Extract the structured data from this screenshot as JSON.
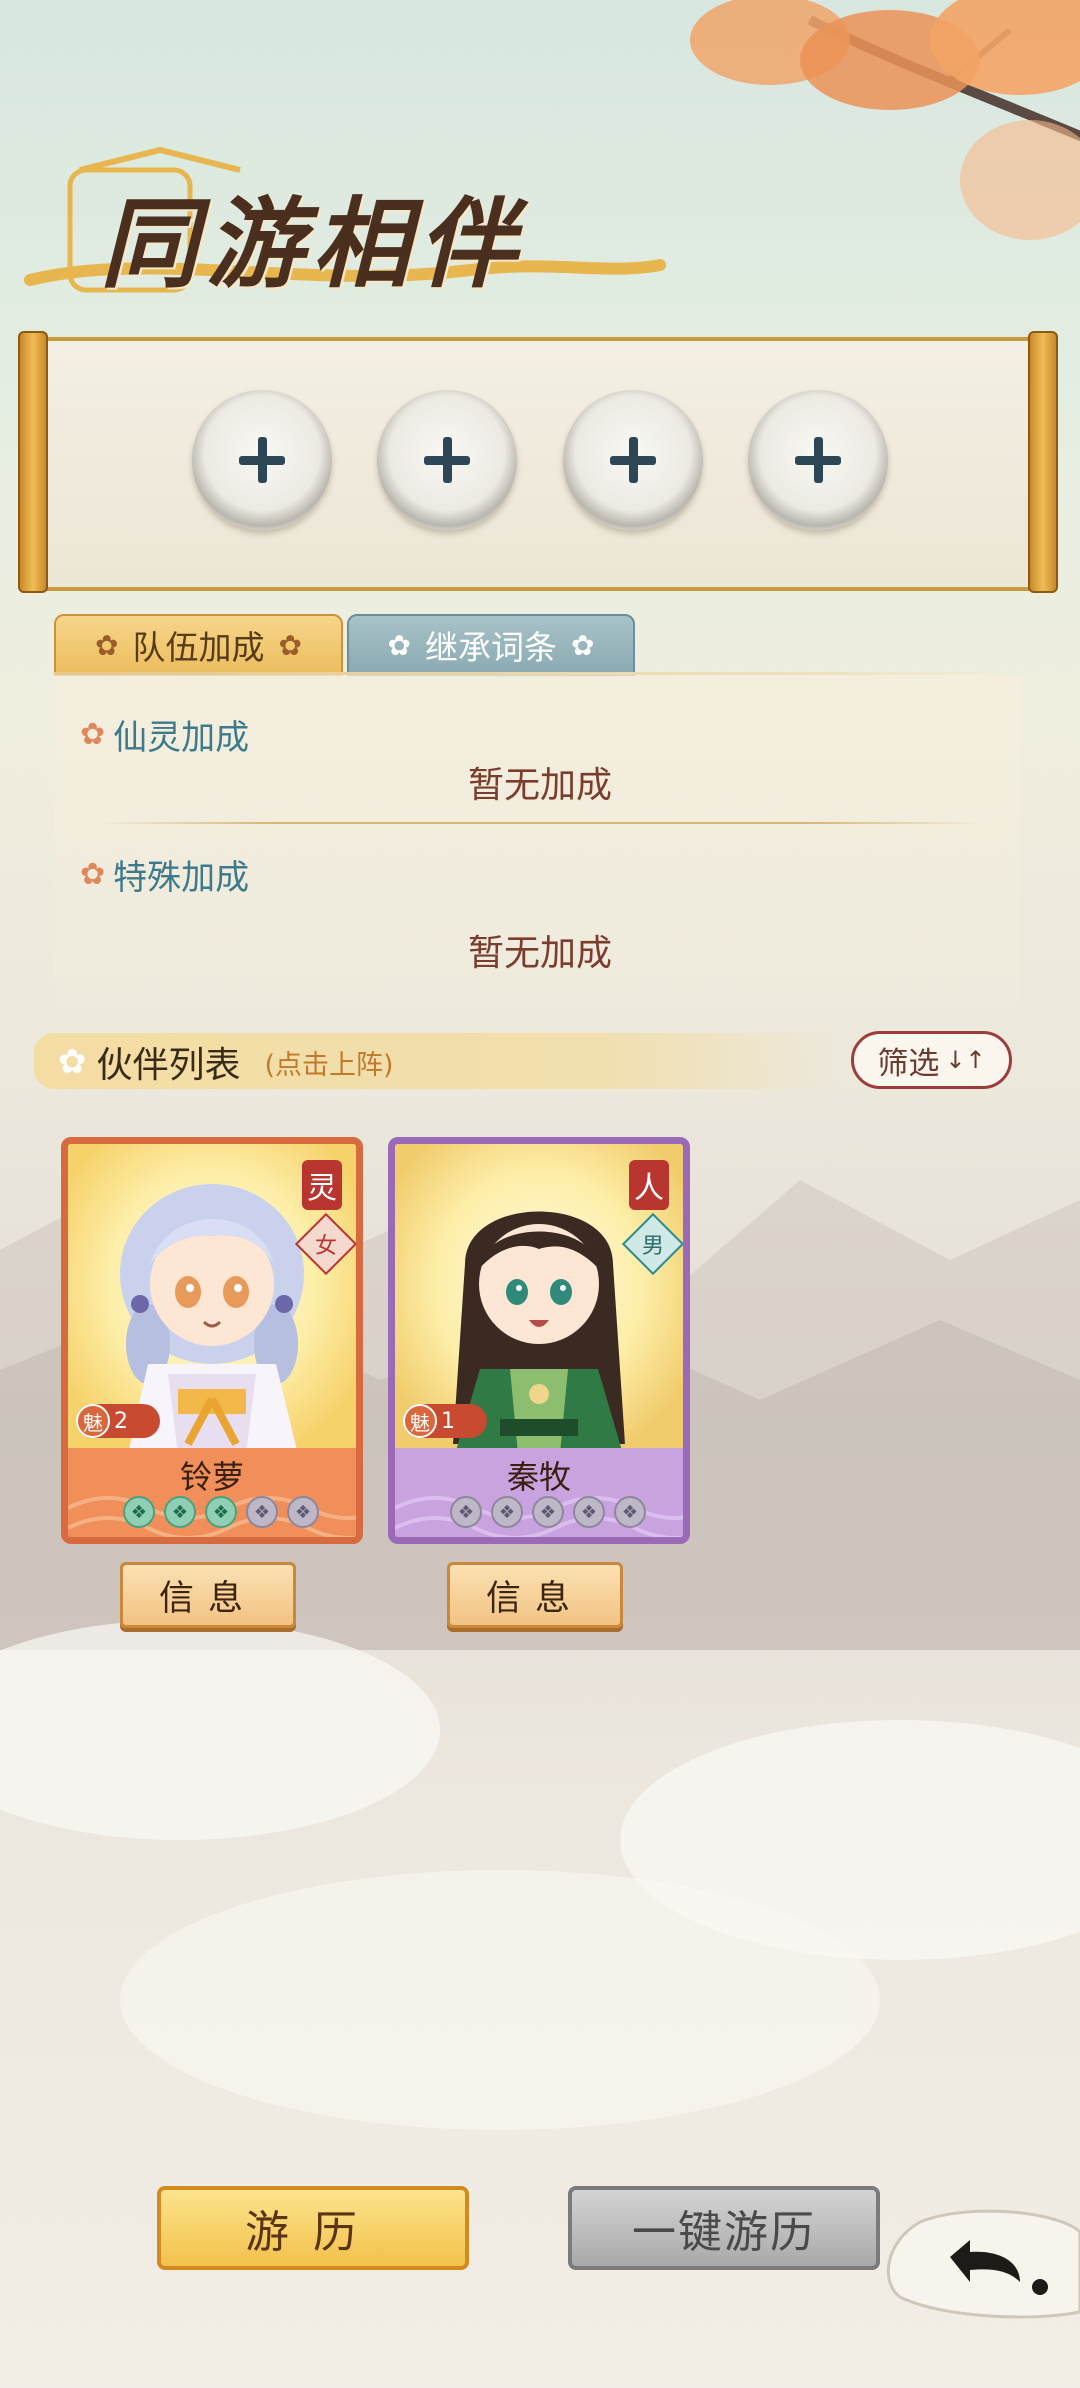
{
  "header": {
    "title": "同游相伴"
  },
  "team_slots": [
    {
      "icon": "plus-icon"
    },
    {
      "icon": "plus-icon"
    },
    {
      "icon": "plus-icon"
    },
    {
      "icon": "plus-icon"
    }
  ],
  "tabs": [
    {
      "label": "队伍加成",
      "active": true
    },
    {
      "label": "继承词条",
      "active": false
    }
  ],
  "bonuses": [
    {
      "label": "仙灵加成",
      "value": "暂无加成"
    },
    {
      "label": "特殊加成",
      "value": "暂无加成"
    }
  ],
  "companion_list": {
    "title": "伙伴列表",
    "hint": "(点击上阵)",
    "filter_label": "筛选",
    "filter_icon": "↓↑"
  },
  "companions": [
    {
      "name": "铃萝",
      "type": "灵",
      "gender": "女",
      "charm_label": "魅",
      "charm_value": "2",
      "gems_active": 3,
      "gems_total": 5,
      "info_label": "信息",
      "frame_color": "#d86a3f"
    },
    {
      "name": "秦牧",
      "type": "人",
      "gender": "男",
      "charm_label": "魅",
      "charm_value": "1",
      "gems_active": 0,
      "gems_total": 5,
      "info_label": "信息",
      "frame_color": "#9b6ab7"
    }
  ],
  "footer": {
    "travel_label": "游历",
    "onekey_label": "一键游历",
    "back_icon": "back-arrow-icon"
  }
}
